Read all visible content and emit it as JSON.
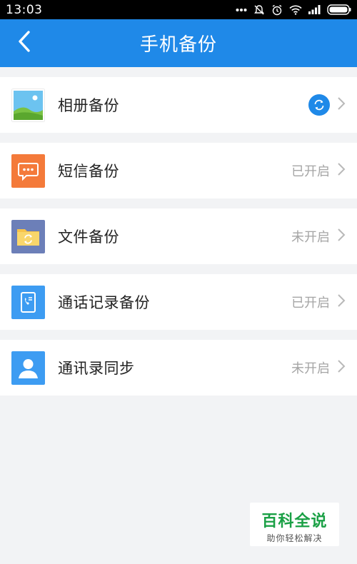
{
  "status_bar": {
    "time": "13:03"
  },
  "header": {
    "title": "手机备份"
  },
  "rows": [
    {
      "label": "相册备份",
      "status": "",
      "icon": "photo-album-icon",
      "color": "#53b7e8"
    },
    {
      "label": "短信备份",
      "status": "已开启",
      "icon": "sms-icon",
      "color": "#f47a3a"
    },
    {
      "label": "文件备份",
      "status": "未开启",
      "icon": "folder-sync-icon",
      "color": "#6c7fb8"
    },
    {
      "label": "通话记录备份",
      "status": "已开启",
      "icon": "call-log-icon",
      "color": "#3d9cf2"
    },
    {
      "label": "通讯录同步",
      "status": "未开启",
      "icon": "contacts-icon",
      "color": "#3d9cf2"
    }
  ],
  "watermark": {
    "title": "百科全说",
    "subtitle": "助你轻松解决"
  },
  "colors": {
    "accent": "#1f89e8",
    "background": "#f2f3f5"
  }
}
